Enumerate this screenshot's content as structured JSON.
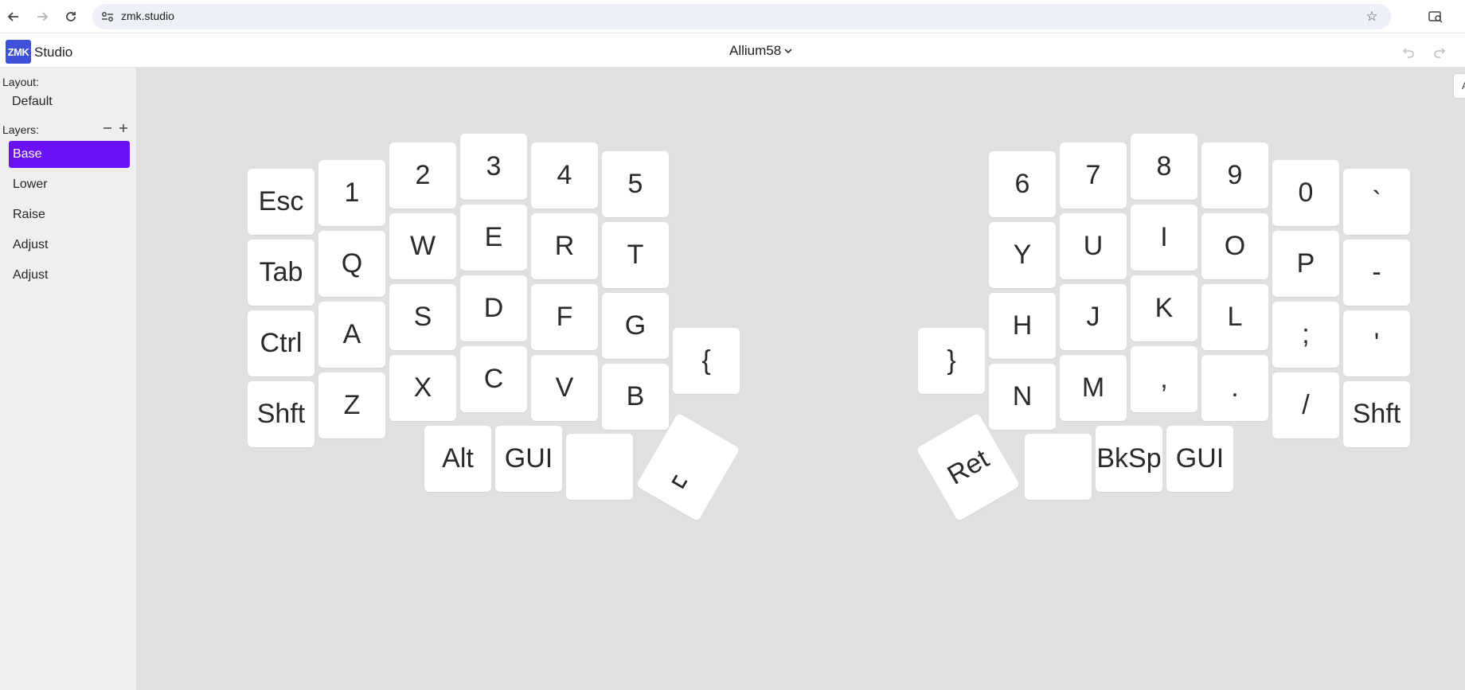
{
  "browser": {
    "url": "zmk.studio"
  },
  "header": {
    "logo_text": "ZMK",
    "brand": "Studio",
    "device_name": "Allium58"
  },
  "sidebar": {
    "layout_label": "Layout:",
    "layout_value": "Default",
    "layers_label": "Layers:",
    "layers": [
      {
        "label": "Base",
        "active": true
      },
      {
        "label": "Lower",
        "active": false
      },
      {
        "label": "Raise",
        "active": false
      },
      {
        "label": "Adjust",
        "active": false
      },
      {
        "label": "Adjust",
        "active": false
      }
    ]
  },
  "side_tab": {
    "label": "A"
  },
  "keys": {
    "l_esc": "Esc",
    "l_1": "1",
    "l_2": "2",
    "l_3": "3",
    "l_4": "4",
    "l_5": "5",
    "l_tab": "Tab",
    "l_q": "Q",
    "l_w": "W",
    "l_e": "E",
    "l_r": "R",
    "l_t": "T",
    "l_ctrl": "Ctrl",
    "l_a": "A",
    "l_s": "S",
    "l_d": "D",
    "l_f": "F",
    "l_g": "G",
    "l_lbrace": "{",
    "l_shft": "Shft",
    "l_z": "Z",
    "l_x": "X",
    "l_c": "C",
    "l_v": "V",
    "l_b": "B",
    "l_alt": "Alt",
    "l_gui": "GUI",
    "l_blank": "",
    "l_space": "␣",
    "r_6": "6",
    "r_7": "7",
    "r_8": "8",
    "r_9": "9",
    "r_0": "0",
    "r_grave": "`",
    "r_y": "Y",
    "r_u": "U",
    "r_i": "I",
    "r_o": "O",
    "r_p": "P",
    "r_minus": "-",
    "r_h": "H",
    "r_j": "J",
    "r_k": "K",
    "r_l": "L",
    "r_semi": ";",
    "r_quote": "'",
    "r_rbrace": "}",
    "r_n": "N",
    "r_m": "M",
    "r_comma": ",",
    "r_dot": ".",
    "r_slash": "/",
    "r_shft": "Shft",
    "r_ret": "Ret",
    "r_blank": "",
    "r_bksp": "BkSp",
    "r_gui": "GUI"
  }
}
